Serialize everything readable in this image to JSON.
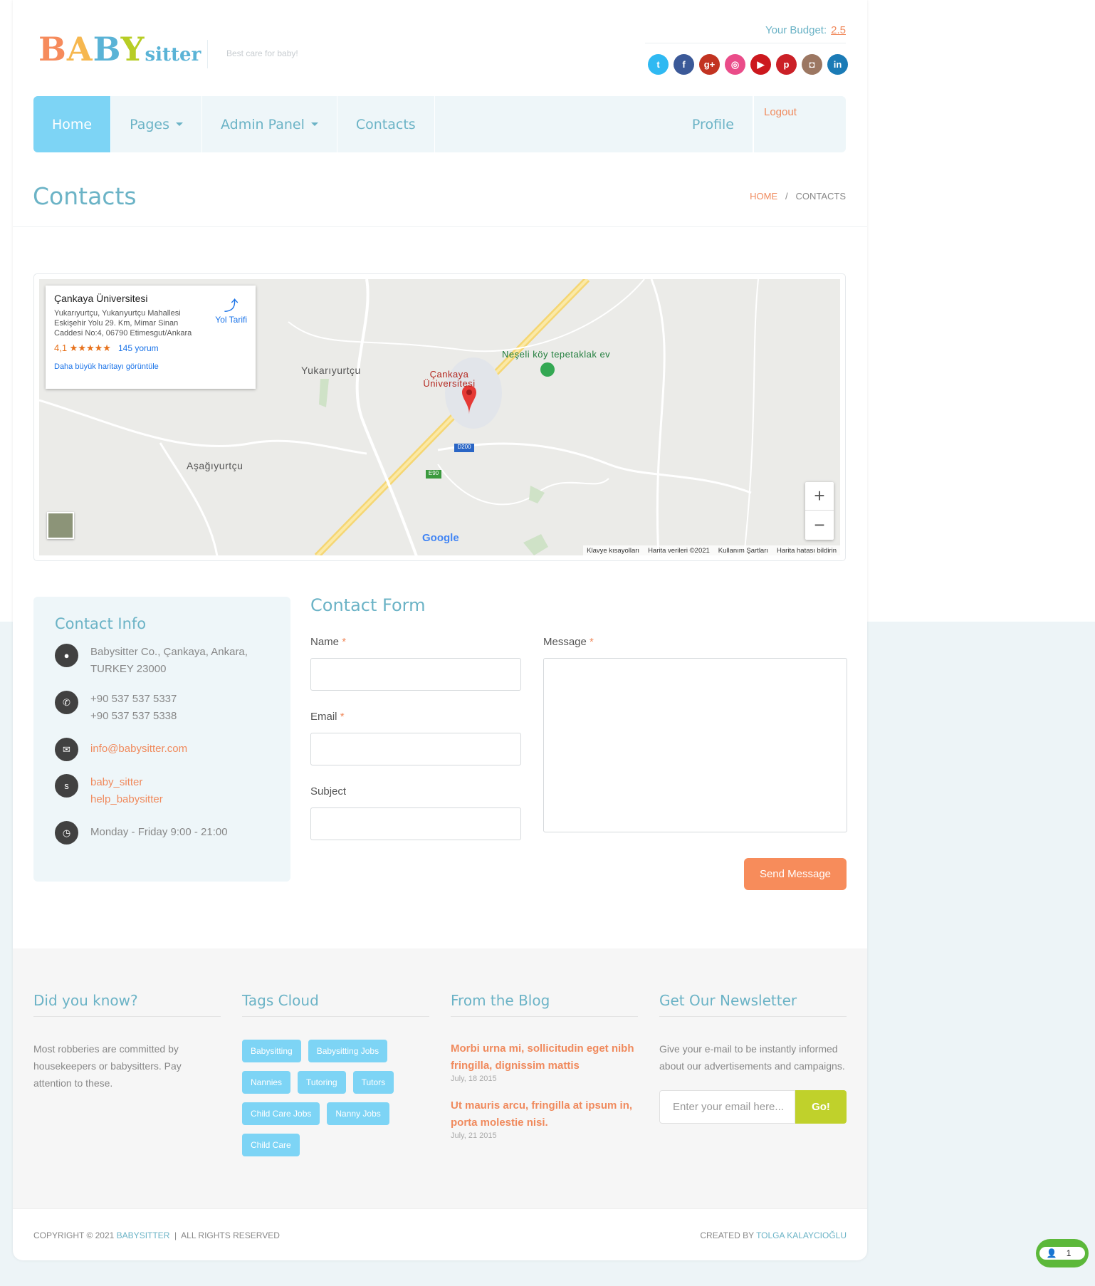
{
  "header": {
    "logo_baby": [
      "B",
      "A",
      "B",
      "Y"
    ],
    "logo_sitter": "sitter",
    "tagline": "Best care for baby!",
    "budget_label": "Your Budget:",
    "budget_value": "2.5",
    "social": [
      {
        "icon": "twitter-icon",
        "glyph": "t",
        "color": "#2fb9f2"
      },
      {
        "icon": "facebook-icon",
        "glyph": "f",
        "color": "#3b5998"
      },
      {
        "icon": "googleplus-icon",
        "glyph": "g+",
        "color": "#c23321"
      },
      {
        "icon": "dribbble-icon",
        "glyph": "◎",
        "color": "#ea4c89"
      },
      {
        "icon": "youtube-icon",
        "glyph": "▶",
        "color": "#cc181e"
      },
      {
        "icon": "pinterest-icon",
        "glyph": "p",
        "color": "#cb2027"
      },
      {
        "icon": "instagram-icon",
        "glyph": "◘",
        "color": "#9c7762"
      },
      {
        "icon": "linkedin-icon",
        "glyph": "in",
        "color": "#1b7bb6"
      }
    ]
  },
  "nav": {
    "home": "Home",
    "pages": "Pages",
    "admin": "Admin Panel",
    "contacts": "Contacts",
    "profile": "Profile",
    "logout": "Logout"
  },
  "page": {
    "title": "Contacts",
    "crumb_home": "HOME",
    "crumb_sep": "/",
    "crumb_current": "CONTACTS"
  },
  "map": {
    "card_title": "Çankaya Üniversitesi",
    "card_address": "Yukarıyurtçu, Yukarıyurtçu Mahallesi Eskişehir Yolu 29. Km, Mimar Sinan Caddesi No:4, 06790 Etimesgut/Ankara",
    "rating": "4,1 ★★★★★",
    "reviews": "145 yorum",
    "bigger": "Daha büyük haritayı görüntüle",
    "directions": "Yol Tarifi",
    "place1": "Yukarıyurtçu",
    "place2": "Aşağıyurtçu",
    "place3": "Çankaya Üniversitesi",
    "place4": "Neşeli köy tepetaklak ev",
    "road1": "D200",
    "road2": "E90",
    "google": "Google",
    "footer": [
      "Klavye kısayolları",
      "Harita verileri ©2021",
      "Kullanım Şartları",
      "Harita hatası bildirin"
    ]
  },
  "contact_info": {
    "title": "Contact Info",
    "address": "Babysitter Co., Çankaya, Ankara, TURKEY 23000",
    "phone1": "+90 537 537 5337",
    "phone2": "+90 537 537 5338",
    "email": "info@babysitter.com",
    "skype1": "baby_sitter",
    "skype2": "help_babysitter",
    "hours": "Monday - Friday 9:00 - 21:00"
  },
  "form": {
    "title": "Contact Form",
    "name": "Name",
    "email": "Email",
    "subject": "Subject",
    "message": "Message",
    "required": "*",
    "send": "Send Message"
  },
  "footer": {
    "did_title": "Did you know?",
    "did_text": "Most robberies are committed by housekeepers or babysitters. Pay attention to these.",
    "tags_title": "Tags Cloud",
    "tags": [
      "Babysitting",
      "Babysitting Jobs",
      "Nannies",
      "Tutoring",
      "Tutors",
      "Child Care Jobs",
      "Nanny Jobs",
      "Child Care"
    ],
    "blog_title": "From the Blog",
    "posts": [
      {
        "title": "Morbi urna mi, sollicitudin eget nibh fringilla, dignissim mattis",
        "date": "July, 18 2015"
      },
      {
        "title": "Ut mauris arcu, fringilla at ipsum in, porta molestie nisi.",
        "date": "July, 21 2015"
      }
    ],
    "news_title": "Get Our Newsletter",
    "news_text": "Give your e-mail to be instantly informed about our advertisements and campaigns.",
    "news_placeholder": "Enter your email here...",
    "news_go": "Go!"
  },
  "bottom": {
    "copy": "COPYRIGHT © 2021",
    "brand": "BABYSITTER",
    "sep": "|",
    "rights": "ALL RIGHTS RESERVED",
    "created": "CREATED BY",
    "author": "TOLGA KALAYCIOĞLU"
  },
  "chat": {
    "count": "1"
  }
}
